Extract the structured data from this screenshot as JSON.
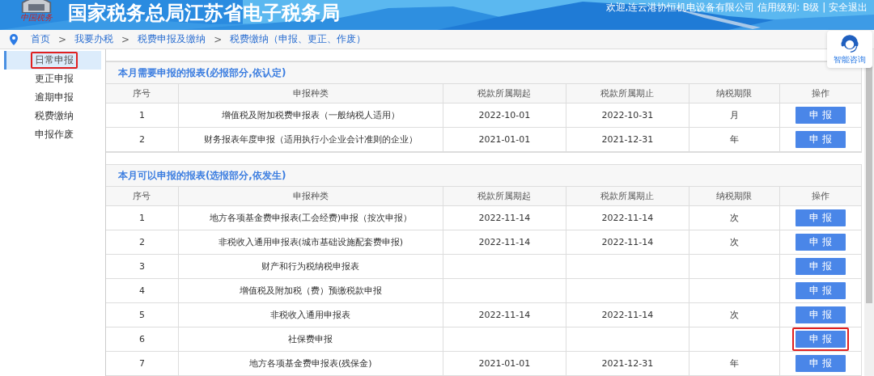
{
  "header": {
    "logo_text": "中国税务",
    "title": "国家税务总局江苏省电子税务局",
    "user_info": "欢迎,连云港协恒机电设备有限公司 信用级别: B级 | 安全退出"
  },
  "breadcrumb": [
    "首页",
    "我要办税",
    "税费申报及缴纳",
    "税费缴纳（申报、更正、作废）"
  ],
  "breadcrumb_separator": ">",
  "sidebar": {
    "items": [
      {
        "label": "日常申报",
        "selected": true,
        "highlighted": true
      },
      {
        "label": "更正申报",
        "selected": false,
        "highlighted": false
      },
      {
        "label": "逾期申报",
        "selected": false,
        "highlighted": false
      },
      {
        "label": "税费缴纳",
        "selected": false,
        "highlighted": false
      },
      {
        "label": "申报作废",
        "selected": false,
        "highlighted": false
      }
    ]
  },
  "assistant": {
    "label": "智能咨询"
  },
  "sections": [
    {
      "title": "本月需要申报的报表(必报部分,依认定)",
      "columns": [
        "序号",
        "申报种类",
        "税款所属期起",
        "税款所属期止",
        "纳税期限",
        "操作"
      ],
      "rows": [
        {
          "cells": [
            "1",
            "增值税及附加税费申报表（一般纳税人适用）",
            "2022-10-01",
            "2022-10-31",
            "月"
          ],
          "action": "申 报",
          "highlighted": false
        },
        {
          "cells": [
            "2",
            "财务报表年度申报（适用执行小企业会计准则的企业）",
            "2021-01-01",
            "2021-12-31",
            "年"
          ],
          "action": "申 报",
          "highlighted": false
        }
      ]
    },
    {
      "title": "本月可以申报的报表(选报部分,依发生)",
      "columns": [
        "序号",
        "申报种类",
        "税款所属期起",
        "税款所属期止",
        "纳税期限",
        "操作"
      ],
      "rows": [
        {
          "cells": [
            "1",
            "地方各项基金费申报表(工会经费)申报（按次申报）",
            "2022-11-14",
            "2022-11-14",
            "次"
          ],
          "action": "申 报",
          "highlighted": false
        },
        {
          "cells": [
            "2",
            "非税收入通用申报表(城市基础设施配套费申报)",
            "2022-11-14",
            "2022-11-14",
            "次"
          ],
          "action": "申 报",
          "highlighted": false
        },
        {
          "cells": [
            "3",
            "财产和行为税纳税申报表",
            "",
            "",
            ""
          ],
          "action": "申 报",
          "highlighted": false
        },
        {
          "cells": [
            "4",
            "增值税及附加税（费）预缴税款申报",
            "",
            "",
            ""
          ],
          "action": "申 报",
          "highlighted": false
        },
        {
          "cells": [
            "5",
            "非税收入通用申报表",
            "2022-11-14",
            "2022-11-14",
            "次"
          ],
          "action": "申 报",
          "highlighted": false
        },
        {
          "cells": [
            "6",
            "社保费申报",
            "",
            "",
            ""
          ],
          "action": "申 报",
          "highlighted": true
        },
        {
          "cells": [
            "7",
            "地方各项基金费申报表(残保金)",
            "2021-01-01",
            "2021-12-31",
            "年"
          ],
          "action": "申 报",
          "highlighted": false
        }
      ]
    }
  ]
}
